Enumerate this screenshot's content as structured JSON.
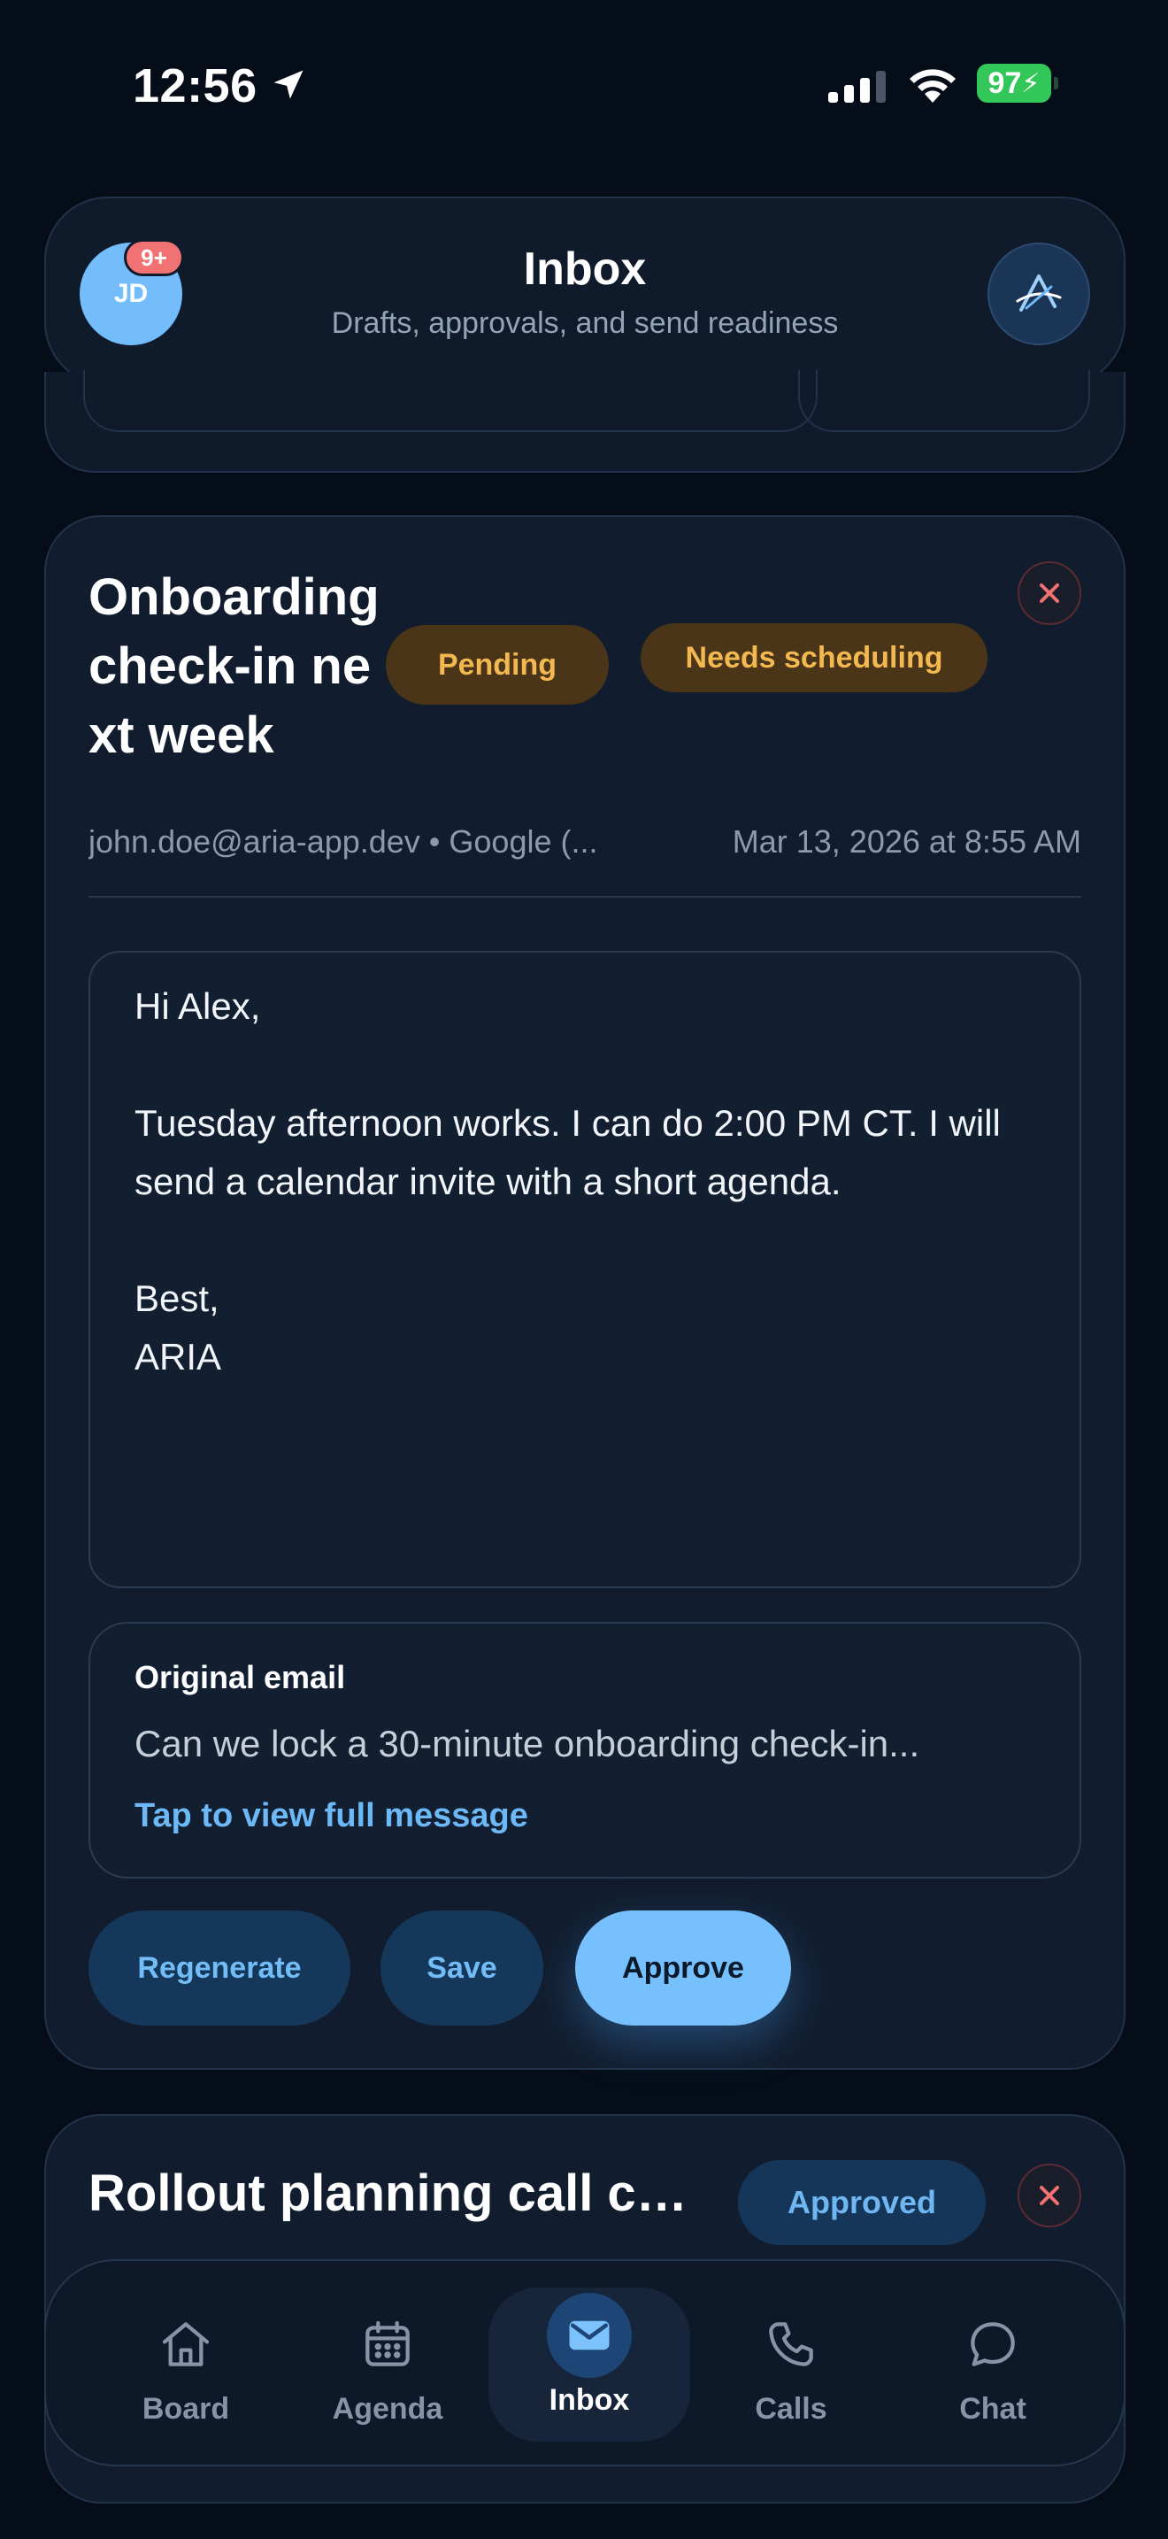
{
  "status_bar": {
    "time": "12:56",
    "battery": "97"
  },
  "header": {
    "avatar_initials": "JD",
    "notification_count": "9+",
    "title": "Inbox",
    "subtitle": "Drafts, approvals, and send readiness"
  },
  "draft_card": {
    "title": "Onboarding check-in next week",
    "status_chip": "Pending",
    "tag_chip": "Needs scheduling",
    "from": "john.doe@aria-app.dev • Google (...",
    "date": "Mar 13, 2026 at 8:55 AM",
    "body": "Hi Alex,\n\nTuesday afternoon works. I can do 2:00 PM CT. I will send a calendar invite with a short agenda.\n\nBest,\nARIA",
    "original_email": {
      "label": "Original email",
      "snippet": "Can we lock a 30-minute onboarding check-in...",
      "link": "Tap to view full message"
    },
    "actions": {
      "regenerate": "Regenerate",
      "save": "Save",
      "approve": "Approve"
    }
  },
  "next_card": {
    "title": "Rollout planning call co...",
    "status_chip": "Approved"
  },
  "tabs": [
    {
      "label": "Board",
      "icon": "home-icon"
    },
    {
      "label": "Agenda",
      "icon": "calendar-icon"
    },
    {
      "label": "Inbox",
      "icon": "mail-icon",
      "active": true
    },
    {
      "label": "Calls",
      "icon": "phone-icon"
    },
    {
      "label": "Chat",
      "icon": "chat-bubble-icon"
    }
  ],
  "colors": {
    "background": "#050d18",
    "card": "#111d2e",
    "accent": "#76c0fd",
    "pending_chip": "#4a3518",
    "pending_text": "#f3b850",
    "close_icon": "#f07272",
    "battery": "#33c759"
  }
}
